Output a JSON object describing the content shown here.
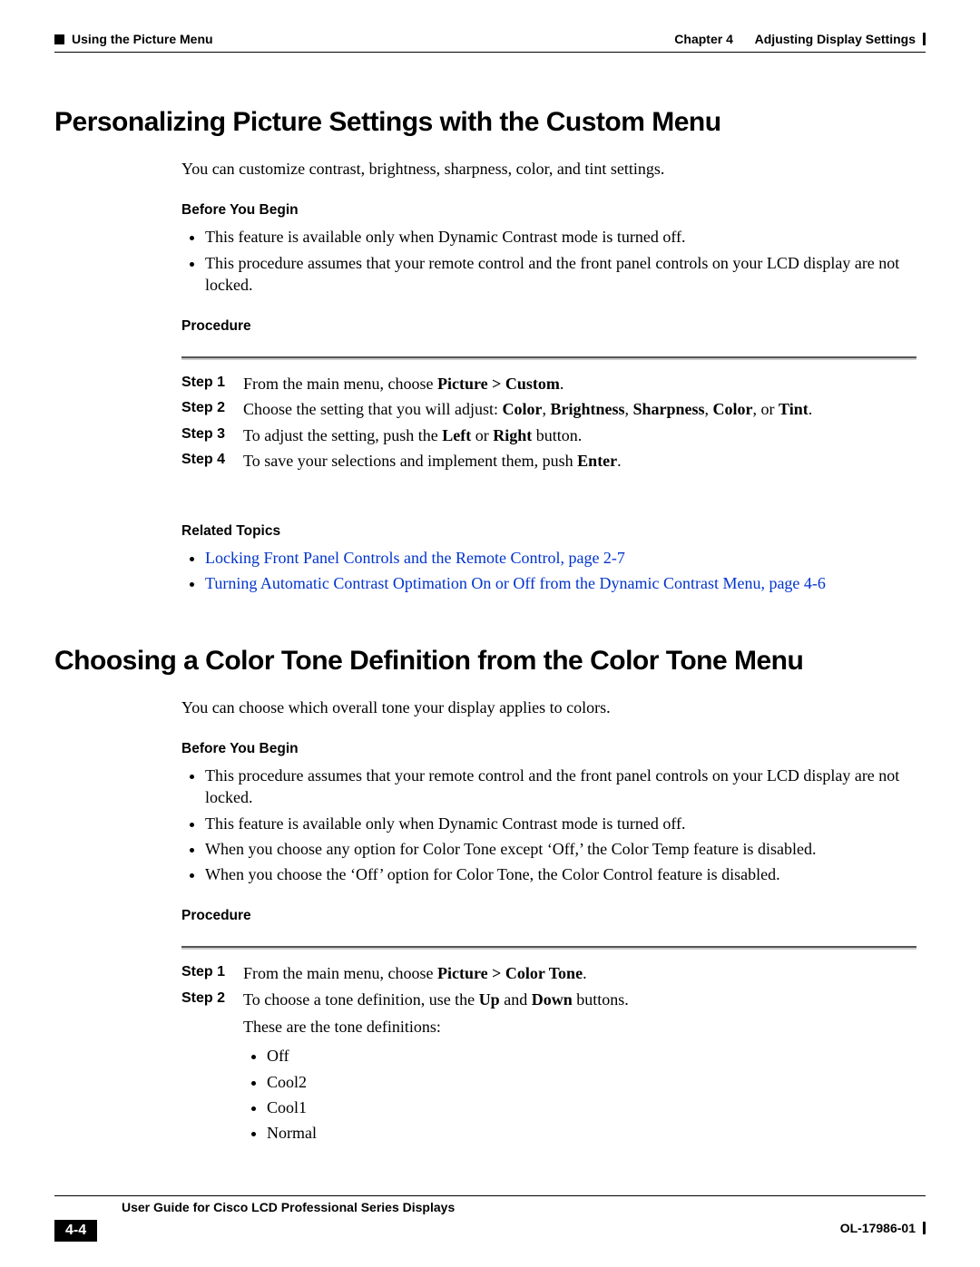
{
  "header": {
    "left_text": "Using the Picture Menu",
    "right_prefix": "Chapter 4",
    "right_text": "Adjusting Display Settings"
  },
  "section1": {
    "title": "Personalizing Picture Settings with the Custom Menu",
    "intro": "You can customize contrast, brightness, sharpness, color, and tint settings.",
    "before_heading": "Before You Begin",
    "before_items": [
      "This feature is available only when Dynamic Contrast mode is turned off.",
      "This procedure assumes that your remote control and the front panel controls on your LCD display are not locked."
    ],
    "procedure_heading": "Procedure",
    "steps": [
      {
        "label": "Step 1",
        "prefix": "From the main menu, choose ",
        "bold": "Picture > Custom",
        "suffix": "."
      },
      {
        "label": "Step 2",
        "prefix": "Choose the setting that you will adjust: ",
        "bold": "Color",
        "mid1": ", ",
        "bold2": "Brightness",
        "mid2": ", ",
        "bold3": "Sharpness",
        "mid3": ", ",
        "bold4": "Color",
        "mid4": ", or ",
        "bold5": "Tint",
        "suffix": "."
      },
      {
        "label": "Step 3",
        "prefix": "To adjust the setting, push the ",
        "bold": "Left",
        "mid1": " or ",
        "bold2": "Right",
        "suffix": " button."
      },
      {
        "label": "Step 4",
        "prefix": "To save your selections and implement them, push ",
        "bold": "Enter",
        "suffix": "."
      }
    ],
    "related_heading": "Related Topics",
    "related_links": [
      "Locking Front Panel Controls and the Remote Control, page 2-7",
      "Turning Automatic Contrast Optimation On or Off from the Dynamic Contrast Menu, page 4-6"
    ]
  },
  "section2": {
    "title": "Choosing a Color Tone Definition from the Color Tone Menu",
    "intro": "You can choose which overall tone your display applies to colors.",
    "before_heading": "Before You Begin",
    "before_items": [
      "This procedure assumes that your remote control and the front panel controls on your LCD display are not locked.",
      "This feature is available only when Dynamic Contrast mode is turned off.",
      "When you choose any option for Color Tone except ‘Off,’ the Color Temp feature is disabled.",
      "When you choose the ‘Off’ option for Color Tone, the Color Control feature is disabled."
    ],
    "procedure_heading": "Procedure",
    "step1": {
      "label": "Step 1",
      "prefix": "From the main menu, choose ",
      "bold": "Picture > Color Tone",
      "suffix": "."
    },
    "step2": {
      "label": "Step 2",
      "prefix": "To choose a tone definition, use the ",
      "bold": "Up",
      "mid": " and ",
      "bold2": "Down",
      "suffix": " buttons."
    },
    "step2_cont": "These are the tone definitions:",
    "tone_items": [
      "Off",
      "Cool2",
      "Cool1",
      "Normal"
    ]
  },
  "footer": {
    "guide_title": "User Guide for Cisco LCD Professional Series Displays",
    "page_num": "4-4",
    "doc_id": "OL-17986-01"
  }
}
